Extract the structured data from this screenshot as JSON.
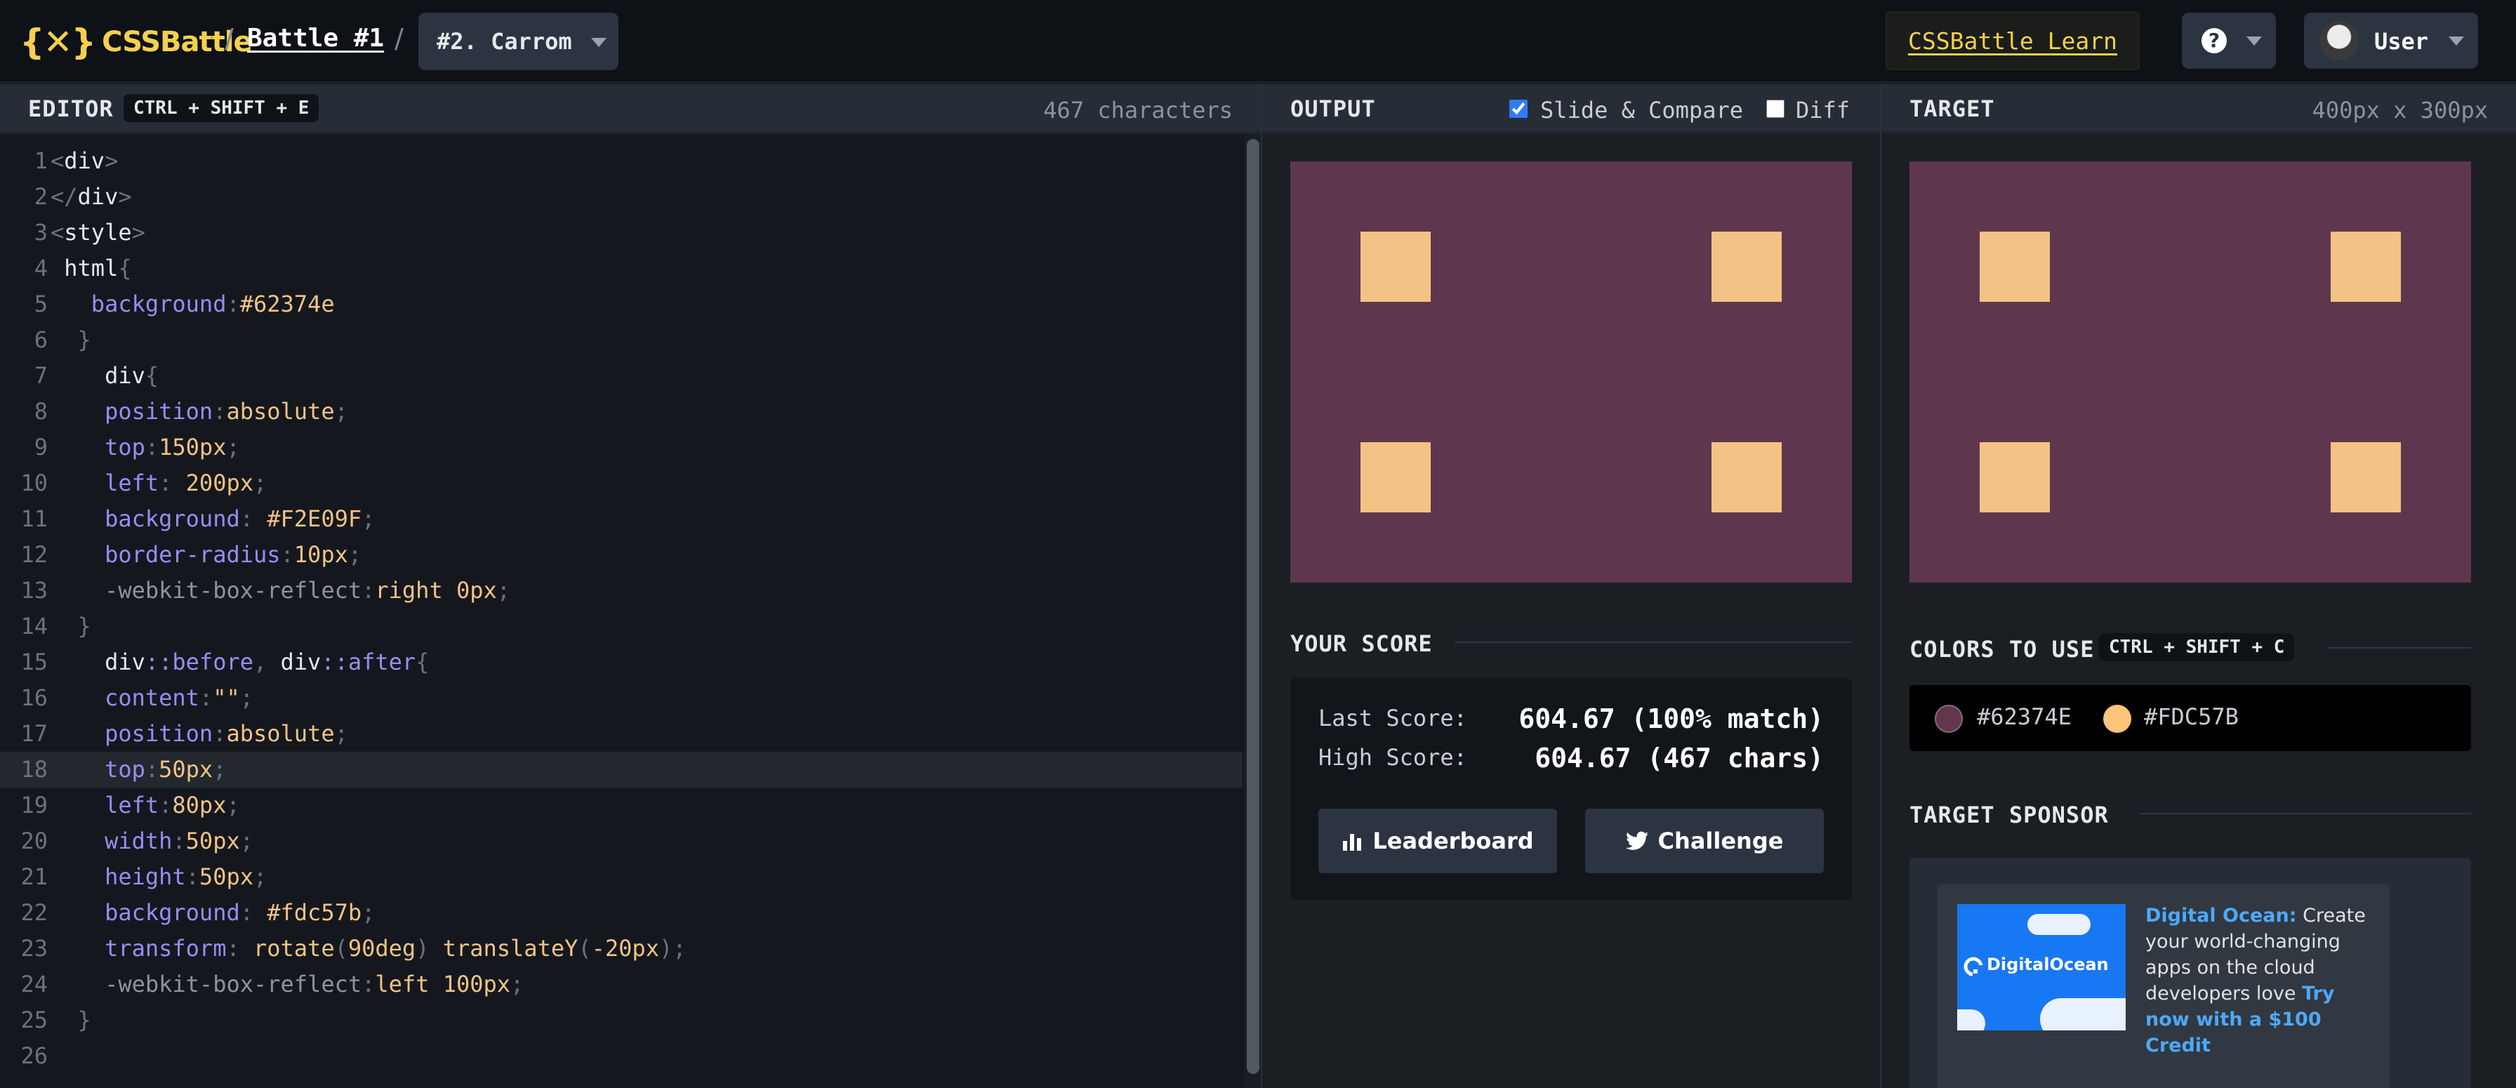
{
  "header": {
    "logo_mark": "{✕}",
    "logo_text": "CSSBattle",
    "separator": "/",
    "battle": "Battle #1",
    "target_select": "#2. Carrom",
    "learn": "CSSBattle Learn",
    "help": "?",
    "user": "User"
  },
  "editor": {
    "title": "EDITOR",
    "shortcut": "CTRL + SHIFT + E",
    "char_count": "467 characters",
    "active_line": 18,
    "lines": [
      {
        "n": "1",
        "html": "<span class='p'>&lt;</span>div<span class='p'>&gt;</span>"
      },
      {
        "n": "2",
        "html": "<span class='p'>&lt;/</span>div<span class='p'>&gt;</span>"
      },
      {
        "n": "3",
        "html": "<span class='p'>&lt;</span>style<span class='p'>&gt;</span>"
      },
      {
        "n": "4",
        "html": " html<span class='p'>{</span>"
      },
      {
        "n": "5",
        "html": "   <span class='k'>background</span><span class='p'>:</span><span class='v'>#62374e</span>"
      },
      {
        "n": "6",
        "html": "  <span class='p'>}</span>"
      },
      {
        "n": "7",
        "html": "    div<span class='p'>{</span>"
      },
      {
        "n": "8",
        "html": "    <span class='k'>position</span><span class='p'>:</span><span class='v'>absolute</span><span class='p'>;</span>"
      },
      {
        "n": "9",
        "html": "    <span class='k'>top</span><span class='p'>:</span><span class='v'>150px</span><span class='p'>;</span>"
      },
      {
        "n": "10",
        "html": "    <span class='k'>left</span><span class='p'>:</span> <span class='v'>200px</span><span class='p'>;</span>"
      },
      {
        "n": "11",
        "html": "    <span class='k'>background</span><span class='p'>:</span> <span class='v'>#F2E09F</span><span class='p'>;</span>"
      },
      {
        "n": "12",
        "html": "    <span class='k'>border-radius</span><span class='p'>:</span><span class='v'>10px</span><span class='p'>;</span>"
      },
      {
        "n": "13",
        "html": "    <span class='g'>-webkit-box-reflect</span><span class='p'>:</span><span class='v'>right 0px</span><span class='p'>;</span>"
      },
      {
        "n": "14",
        "html": "  <span class='p'>}</span>"
      },
      {
        "n": "15",
        "html": "    div<span class='k'>::before</span><span class='p'>,</span> div<span class='k'>::after</span><span class='p'>{</span>"
      },
      {
        "n": "16",
        "html": "    <span class='k'>content</span><span class='p'>:</span><span class='v'>\"\"</span><span class='p'>;</span>"
      },
      {
        "n": "17",
        "html": "    <span class='k'>position</span><span class='p'>:</span><span class='v'>absolute</span><span class='p'>;</span>"
      },
      {
        "n": "18",
        "html": "    <span class='k'>top</span><span class='p'>:</span><span class='v'>50px</span><span class='p'>;</span>"
      },
      {
        "n": "19",
        "html": "    <span class='k'>left</span><span class='p'>:</span><span class='v'>80px</span><span class='p'>;</span>"
      },
      {
        "n": "20",
        "html": "    <span class='k'>width</span><span class='p'>:</span><span class='v'>50px</span><span class='p'>;</span>"
      },
      {
        "n": "21",
        "html": "    <span class='k'>height</span><span class='p'>:</span><span class='v'>50px</span><span class='p'>;</span>"
      },
      {
        "n": "22",
        "html": "    <span class='k'>background</span><span class='p'>:</span> <span class='v'>#fdc57b</span><span class='p'>;</span>"
      },
      {
        "n": "23",
        "html": "    <span class='k'>transform</span><span class='p'>:</span> <span class='v'>rotate</span><span class='p'>(</span><span class='v'>90deg</span><span class='p'>)</span> <span class='v'>translateY</span><span class='p'>(</span><span class='v'>-20px</span><span class='p'>);</span>"
      },
      {
        "n": "24",
        "html": "    <span class='g'>-webkit-box-reflect</span><span class='p'>:</span><span class='v'>left 100px</span><span class='p'>;</span>"
      },
      {
        "n": "25",
        "html": "  <span class='p'>}</span>"
      },
      {
        "n": "26",
        "html": ""
      }
    ]
  },
  "output": {
    "title": "OUTPUT",
    "slide_compare": "Slide & Compare",
    "slide_compare_checked": true,
    "diff": "Diff",
    "diff_checked": false
  },
  "target": {
    "title": "TARGET",
    "dimensions": "400px x 300px"
  },
  "score": {
    "title": "YOUR SCORE",
    "last_label": "Last Score:",
    "last_value": "604.67 (100% match)",
    "high_label": "High Score:",
    "high_value": "604.67 (467 chars)",
    "leaderboard": "Leaderboard",
    "challenge": "Challenge"
  },
  "colors": {
    "title": "COLORS TO USE",
    "shortcut": "CTRL + SHIFT + C",
    "items": [
      {
        "hex": "#62374E",
        "swatch": "#62374e"
      },
      {
        "hex": "#FDC57B",
        "swatch": "#fdc57b"
      }
    ]
  },
  "sponsor": {
    "title": "TARGET SPONSOR",
    "brand": "DigitalOcean",
    "headline": "Digital Ocean:",
    "body": " Create your world-changing apps on the cloud developers love ",
    "cta": "Try now with a $100 Credit"
  },
  "theme": {
    "canvas_bg": "#5e374e",
    "square": "#f2c384",
    "accent_yellow": "#f5d04c"
  }
}
